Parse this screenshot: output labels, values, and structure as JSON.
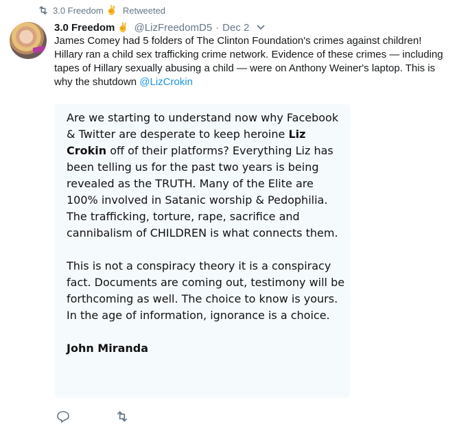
{
  "retweet": {
    "retweeter": "3.0 Freedom",
    "hand_glyph": "✌",
    "label": "Retweeted"
  },
  "author": {
    "name": "3.0 Freedom",
    "hand_glyph": "✌",
    "handle": "@LizFreedomD5",
    "separator": "·",
    "date": "Dec 2"
  },
  "tweet": {
    "text": "James Comey had 5 folders of The Clinton Foundation's crimes against children! Hillary ran a child sex trafficking crime network. Evidence of these crimes — including tapes of Hillary sexually abusing a child — were on Anthony Weiner's laptop. This is why the shutdown ",
    "mention": "@LizCrokin"
  },
  "card": {
    "p1_before": "Are we starting to understand now why Facebook & Twitter are desperate to keep heroine ",
    "p1_bold": "Liz Crokin",
    "p1_after": " off of their platforms? Everything Liz has been telling us for the past two years is being revealed as the TRUTH. Many of the Elite are 100% involved in Satanic worship & Pedophilia. The trafficking, torture, rape, sacrifice and cannibalism of CHILDREN is what connects them.",
    "p2": "This is not a conspiracy theory it is a conspiracy fact. Documents are coming out, testimony will be forthcoming as well. The choice to know is yours. In the age of information, ignorance is a choice.",
    "signature": "John Miranda"
  },
  "icons": {
    "retweet": "retweet-icon",
    "reply": "reply-icon",
    "chevron": "chevron-down-icon"
  },
  "colors": {
    "link": "#1b95e0",
    "muted": "#657786",
    "card_bg": "#f5fafd"
  }
}
